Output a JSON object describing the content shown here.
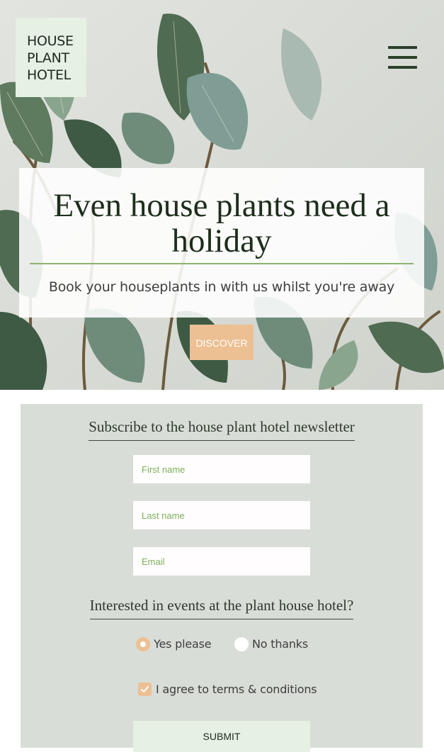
{
  "brand": {
    "logo_text": "HOUSE\nPLANT\nHOTEL"
  },
  "hero": {
    "headline": "Even house plants need a holiday",
    "subheadline": "Book your houseplants in with us whilst you're away",
    "cta_label": "DISCOVER"
  },
  "newsletter": {
    "title": "Subscribe to the house plant hotel newsletter",
    "first_name_placeholder": "First name",
    "last_name_placeholder": "Last name",
    "email_placeholder": "Email",
    "events_question": "Interested in events at the plant house hotel?",
    "radio_yes": "Yes please",
    "radio_no": "No thanks",
    "radio_selected": "Yes please",
    "terms_label": "I agree to terms & conditions",
    "terms_checked": true,
    "submit_label": "SUBMIT"
  },
  "icons": {
    "menu": "hamburger-menu-icon",
    "check": "checkmark-icon"
  },
  "colors": {
    "brand_green": "#1d2b1c",
    "accent_peach": "#ecc093",
    "mint": "#e6f0e3",
    "panel_gray": "#d9ddd7",
    "rule_green": "#8fb36d"
  }
}
